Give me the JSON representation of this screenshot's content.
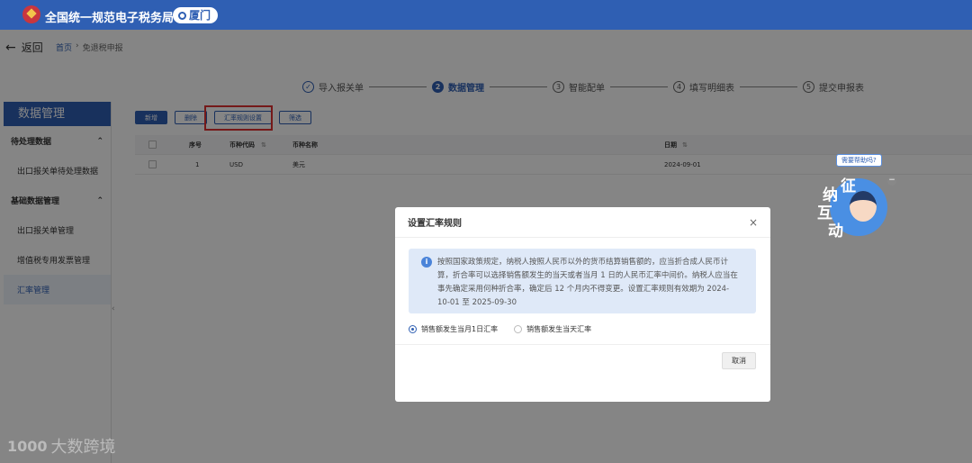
{
  "header": {
    "brand": "全国统一规范电子税务局",
    "city": "厦门"
  },
  "nav": {
    "back_label": "返回",
    "breadcrumb": [
      "首页",
      "免退税申报"
    ]
  },
  "steps": [
    {
      "num": "✓",
      "label": "导入报关单",
      "state": "done"
    },
    {
      "num": "2",
      "label": "数据管理",
      "state": "active"
    },
    {
      "num": "3",
      "label": "智能配单",
      "state": "todo"
    },
    {
      "num": "4",
      "label": "填写明细表",
      "state": "todo"
    },
    {
      "num": "5",
      "label": "提交申报表",
      "state": "todo"
    }
  ],
  "sidebar": {
    "title": "数据管理",
    "groups": [
      {
        "label": "待处理数据",
        "items": [
          "出口报关单待处理数据"
        ]
      },
      {
        "label": "基础数据管理",
        "items": [
          "出口报关单管理",
          "增值税专用发票管理",
          "汇率管理"
        ]
      }
    ],
    "active_item": "汇率管理"
  },
  "toolbar": {
    "add": "新增",
    "delete": "删除",
    "rate_rule": "汇率规则设置",
    "filter": "筛选"
  },
  "table": {
    "headers": {
      "index": "序号",
      "code": "币种代码",
      "name": "币种名称",
      "date": "日期"
    },
    "rows": [
      {
        "index": "1",
        "code": "USD",
        "name": "美元",
        "date": "2024-09-01"
      }
    ]
  },
  "modal": {
    "title": "设置汇率规则",
    "notice_lines": [
      "按照国家政策规定，纳税人按照人民币以外的货币结算销售额的，应当折合成人民币计",
      "算，折合率可以选择销售额发生的当天或者当月 1 日的人民币汇率中间价。纳税人应当在",
      "事先确定采用何种折合率，确定后 12 个月内不得变更。设置汇率规则有效期为 2024-",
      "10-01 至 2025-09-30"
    ],
    "options": [
      "销售额发生当月1日汇率",
      "销售额发生当天汇率"
    ],
    "selected_option": 0,
    "cancel": "取消"
  },
  "assistant": {
    "bubble": "需要帮助吗?",
    "chars": [
      "征",
      "纳",
      "互",
      "动"
    ]
  },
  "watermark": {
    "logo": "1000",
    "text": "大数跨境"
  },
  "colors": {
    "primary": "#2f5fb3",
    "highlight": "#e03030"
  }
}
